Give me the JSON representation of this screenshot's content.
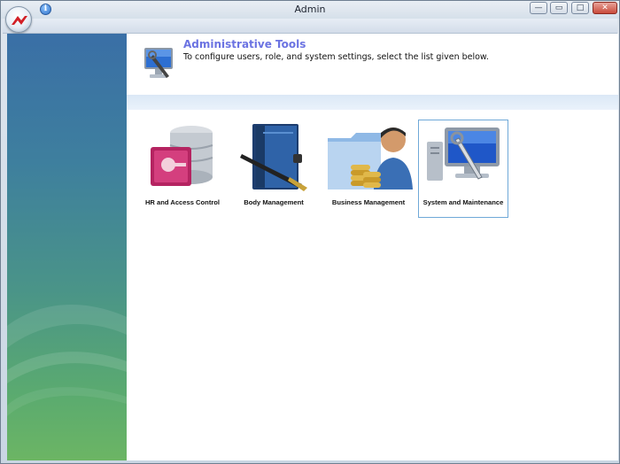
{
  "window": {
    "title": "Admin"
  },
  "titlebar": {
    "info_glyph": "i",
    "controls": {
      "minimize": "—",
      "restore": "▭",
      "maximize": "□",
      "close": "✕"
    }
  },
  "header": {
    "title": "Administrative Tools",
    "subtitle": "To configure users, role, and system settings, select the list given below."
  },
  "tools": [
    {
      "label": "HR and Access Control",
      "icon": "database-key-icon",
      "selected": false
    },
    {
      "label": "Body Management",
      "icon": "book-pen-icon",
      "selected": false
    },
    {
      "label": "Business Management",
      "icon": "folder-person-coins-icon",
      "selected": false
    },
    {
      "label": "System and Maintenance",
      "icon": "monitor-wrench-icon",
      "selected": true
    }
  ],
  "colors": {
    "title_accent": "#6b73e2",
    "selection_border": "#6fa9d8",
    "close_button": "#c94a3a"
  }
}
